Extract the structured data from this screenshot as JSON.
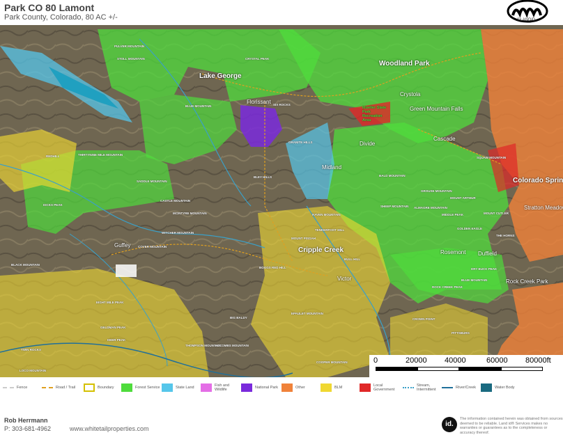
{
  "header": {
    "title": "Park CO 80 Lamont",
    "subtitle": "Park County, Colorado, 80 AC +/-",
    "logo_text": "©LANDiD"
  },
  "map": {
    "towns": [
      "Lake George",
      "Woodland Park",
      "Crystola",
      "Green Mountain Falls",
      "Cascade",
      "Florissant",
      "Midland",
      "Cripple Creek",
      "Victor",
      "Divide",
      "Colorado Springs",
      "Stratton Meadows",
      "Rock Creek Park",
      "Rosemont",
      "Duffield",
      "Guffey"
    ],
    "feature_labels": [
      "PULVER MOUNTAIN",
      "STOLL MOUNTAIN",
      "CRYSTAL PEAK",
      "BLUE MOUNTAIN",
      "SIX ROCKS",
      "GRANITE HILLS",
      "BLEY HILLS",
      "CASTLE MOUNTAIN",
      "MCINTYRE MOUNTAIN",
      "WITCHER MOUNTAIN",
      "COVER MOUNTAIN",
      "BLACK MOUNTAIN",
      "THIRTYNINE MILE MOUNTAIN",
      "SADDLE MOUNTAIN",
      "DICKS PEAK",
      "REDHILL",
      "RAVEN MOUNTAIN",
      "TENDERFOOT HILL",
      "MOUNT PISGAH",
      "BOGGS RED HILL",
      "BULL HILL",
      "SQUAW MOUNTAIN",
      "GROUSE MOUNTAIN",
      "BALD MOUNTAIN",
      "MOUNT CUTLER",
      "GOLDEN EAGLE",
      "THE HORNS",
      "CROWN POINT",
      "PITTSBURG",
      "SHEEP MOUNTAIN",
      "EIGHT MILE PEAK",
      "GELDMAN PEAK",
      "DEER PEAK",
      "THOMPSON MOUNTAIN",
      "MCCOMBS MOUNTAIN",
      "COOPER MOUNTAIN",
      "BIG BALDY",
      "TWIN ROCKS",
      "EPAULET MOUNTAIN",
      "DRY BUCK PEAK",
      "MOUNT ARTHUR",
      "ALMAGRE MOUNTAIN",
      "ROCK CREEK PEAK",
      "MIDDLE PEAK",
      "LOCO MOUNTAIN",
      "BLUE MOUNTAIN"
    ],
    "recreation_label": "Mueller State Park Recreation Area",
    "scale": {
      "labels": [
        "0",
        "20000",
        "40000",
        "60000",
        "80000ft"
      ]
    }
  },
  "legend": {
    "items": [
      {
        "label": "Fence",
        "color": "#cccccc"
      },
      {
        "label": "Road / Trail",
        "color": "#e0a020"
      },
      {
        "label": "Boundary",
        "color": "#d4c000"
      },
      {
        "label": "Forest Service",
        "color": "#4fdc3c"
      },
      {
        "label": "State Land",
        "color": "#56c6ea"
      },
      {
        "label": "Fish and Wildlife",
        "color": "#e46ee6"
      },
      {
        "label": "National Park",
        "color": "#7a2adc"
      },
      {
        "label": "Other",
        "color": "#f0823a"
      },
      {
        "label": "BLM",
        "color": "#f0d832"
      },
      {
        "label": "Local Government",
        "color": "#e02828"
      },
      {
        "label": "Stream, Intermittent",
        "color": "#3aa0c8"
      },
      {
        "label": "River/Creek",
        "color": "#1f6f9a"
      },
      {
        "label": "Water Body",
        "color": "#1a6a80"
      }
    ]
  },
  "footer": {
    "agent_name": "Rob Herrmann",
    "agent_phone": "P: 303-681-4962",
    "website": "www.whitetailproperties.com",
    "id_logo": "id.",
    "disclaimer": "The information contained herein was obtained from sources deemed to be reliable. Land id® Services makes no warranties or guarantees as to the completeness or accuracy thereof."
  }
}
